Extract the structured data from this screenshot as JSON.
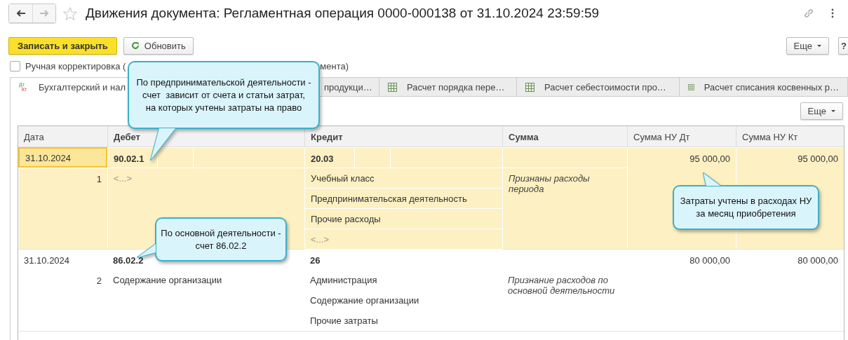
{
  "window": {
    "title": "Движения документа: Регламентная операция 0000-000138 от 31.10.2024 23:59:59"
  },
  "toolbar": {
    "primary": "Записать и закрыть",
    "refresh": "Обновить",
    "more": "Еще",
    "help": "?"
  },
  "manual_edit": {
    "checked": false,
    "label_parts": [
      "Ручная корректировка (",
      "мента)"
    ]
  },
  "tabs": [
    {
      "kind": "accounting",
      "icon_top": "Дт",
      "icon_bottom": "Кт",
      "label": "Бухгалтерский и нал",
      "selected": true
    },
    {
      "kind": "register",
      "label": "продукци…",
      "selected": false
    },
    {
      "kind": "register",
      "label": "Расчет порядка пере…",
      "selected": false
    },
    {
      "kind": "register",
      "label": "Расчет себестоимости про…",
      "selected": false
    },
    {
      "kind": "register",
      "label": "Расчет списания косвенных р…",
      "selected": false
    }
  ],
  "table_more": "Еще",
  "table": {
    "columns": [
      {
        "label": "Дата",
        "bold": false
      },
      {
        "label": "Дебет",
        "bold": true
      },
      {
        "label": "Кредит",
        "bold": true
      },
      {
        "label": "Сумма",
        "bold": true
      },
      {
        "label": "Сумма НУ Дт",
        "bold": false
      },
      {
        "label": "Сумма НУ Кт",
        "bold": false
      }
    ],
    "rows": [
      {
        "selected": true,
        "focused": true,
        "date": "31.10.2024",
        "number": "1",
        "debit": "90.02.1",
        "debit_lines": [
          {
            "text": "<...>",
            "muted": true
          }
        ],
        "credit": "20.03",
        "credit_lines": [
          {
            "text": "Учебный класс",
            "muted": false
          },
          {
            "text": "Предпринимательская деятельность",
            "muted": false
          },
          {
            "text": "Прочие расходы",
            "muted": false
          },
          {
            "text": "<...>",
            "muted": true
          }
        ],
        "content": "Признаны расходы периода",
        "nu_dt": "95 000,00",
        "nu_kt": "95 000,00"
      },
      {
        "selected": false,
        "focused": false,
        "date": "31.10.2024",
        "number": "2",
        "debit": "86.02.2",
        "debit_lines": [
          {
            "text": "Содержание организации",
            "muted": false
          }
        ],
        "credit": "26",
        "credit_lines": [
          {
            "text": "Администрация",
            "muted": false
          },
          {
            "text": "Содержание организации",
            "muted": false
          },
          {
            "text": "Прочие затраты",
            "muted": false
          }
        ],
        "content": "Признание расходов по основной деятельности",
        "nu_dt": "80 000,00",
        "nu_kt": "80 000,00"
      }
    ]
  },
  "callouts": [
    {
      "lines": [
        "По предпринимательской деятельности -",
        "счет  зависит от счета и статьи затрат,",
        "на которых учтены затраты на право"
      ]
    },
    {
      "lines": [
        "По основной деятельности -",
        "счет 86.02.2"
      ]
    },
    {
      "lines": [
        "Затраты учтены в расходах НУ",
        "за месяц приобретения"
      ]
    }
  ]
}
